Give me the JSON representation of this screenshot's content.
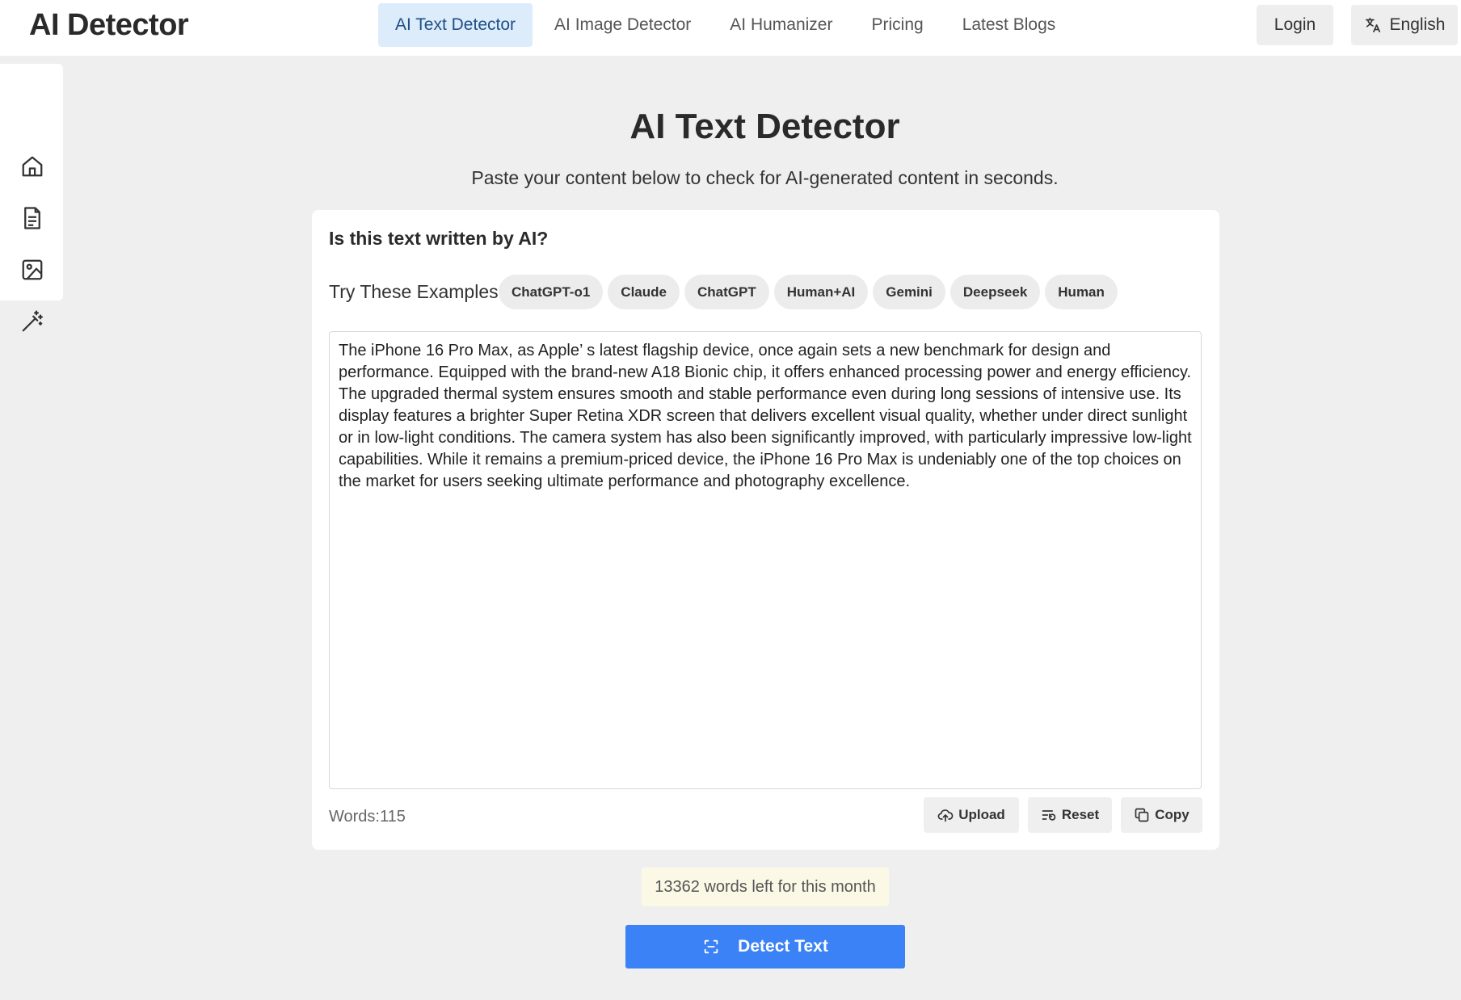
{
  "header": {
    "logo": "AI Detector",
    "nav": [
      {
        "label": "AI Text Detector",
        "active": true
      },
      {
        "label": "AI Image Detector",
        "active": false
      },
      {
        "label": "AI Humanizer",
        "active": false
      },
      {
        "label": "Pricing",
        "active": false
      },
      {
        "label": "Latest Blogs",
        "active": false
      }
    ],
    "login_label": "Login",
    "language_label": "English"
  },
  "sidebar": {
    "items": [
      {
        "icon": "home-icon"
      },
      {
        "icon": "document-icon"
      },
      {
        "icon": "image-icon"
      },
      {
        "icon": "magic-wand-icon"
      }
    ]
  },
  "main": {
    "title": "AI Text Detector",
    "subtitle": "Paste your content below to check for AI-generated content in seconds.",
    "card": {
      "question": "Is this text written by AI?",
      "examples_label": "Try These Examples:",
      "examples": [
        "ChatGPT-o1",
        "Claude",
        "ChatGPT",
        "Human+AI",
        "Gemini",
        "Deepseek",
        "Human"
      ],
      "text": "The iPhone 16 Pro Max, as Apple’ s latest flagship device, once again sets a new benchmark for design and performance. Equipped with the brand-new A18 Bionic chip, it offers enhanced processing power and energy efficiency. The upgraded thermal system ensures smooth and stable performance even during long sessions of intensive use. Its display features a brighter Super Retina XDR screen that delivers excellent visual quality, whether under direct sunlight or in low-light conditions. The camera system has also been significantly improved, with particularly impressive low-light capabilities. While it remains a premium-priced device, the iPhone 16 Pro Max is undeniably one of the top choices on the market for users seeking ultimate performance and photography excellence.",
      "word_count": "Words:115",
      "upload_label": "Upload",
      "reset_label": "Reset",
      "copy_label": "Copy"
    },
    "quota": "13362 words left for this month",
    "detect_label": "Detect Text"
  },
  "colors": {
    "accent": "#3b82f6",
    "active_nav_bg": "#dcecfb",
    "background": "#efefef"
  }
}
